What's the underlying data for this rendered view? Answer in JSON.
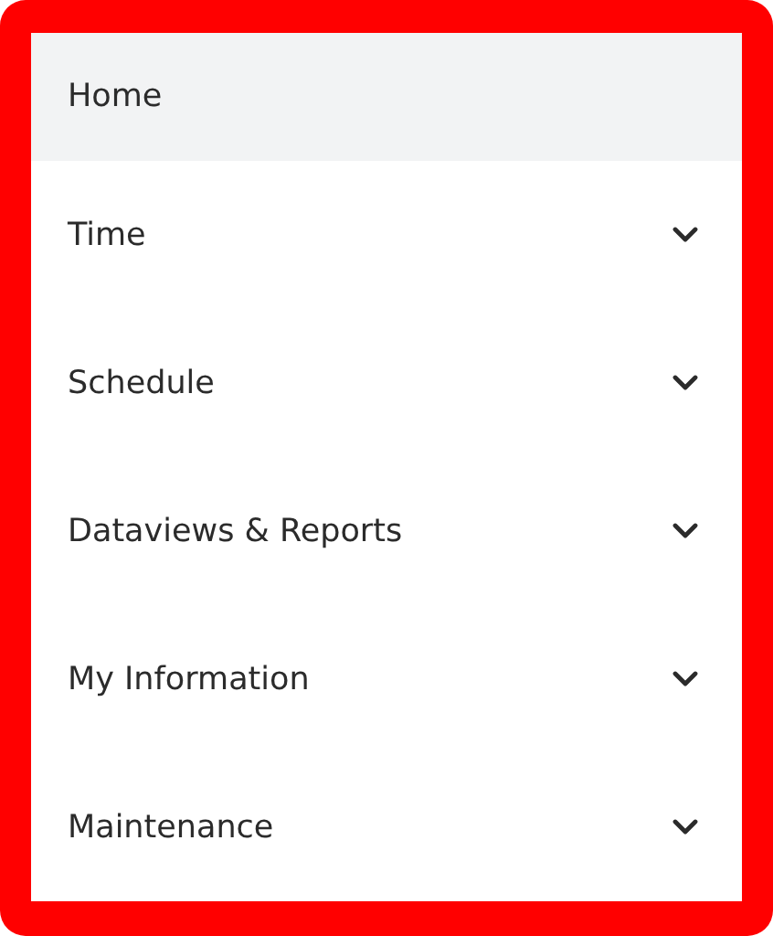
{
  "menu": {
    "items": [
      {
        "label": "Home",
        "kind": "link",
        "selected": true
      },
      {
        "label": "Time",
        "kind": "group",
        "selected": false,
        "expanded": false
      },
      {
        "label": "Schedule",
        "kind": "group",
        "selected": false,
        "expanded": false
      },
      {
        "label": "Dataviews & Reports",
        "kind": "group",
        "selected": false,
        "expanded": false
      },
      {
        "label": "My Information",
        "kind": "group",
        "selected": false,
        "expanded": false
      },
      {
        "label": "Maintenance",
        "kind": "group",
        "selected": false,
        "expanded": false
      }
    ]
  }
}
